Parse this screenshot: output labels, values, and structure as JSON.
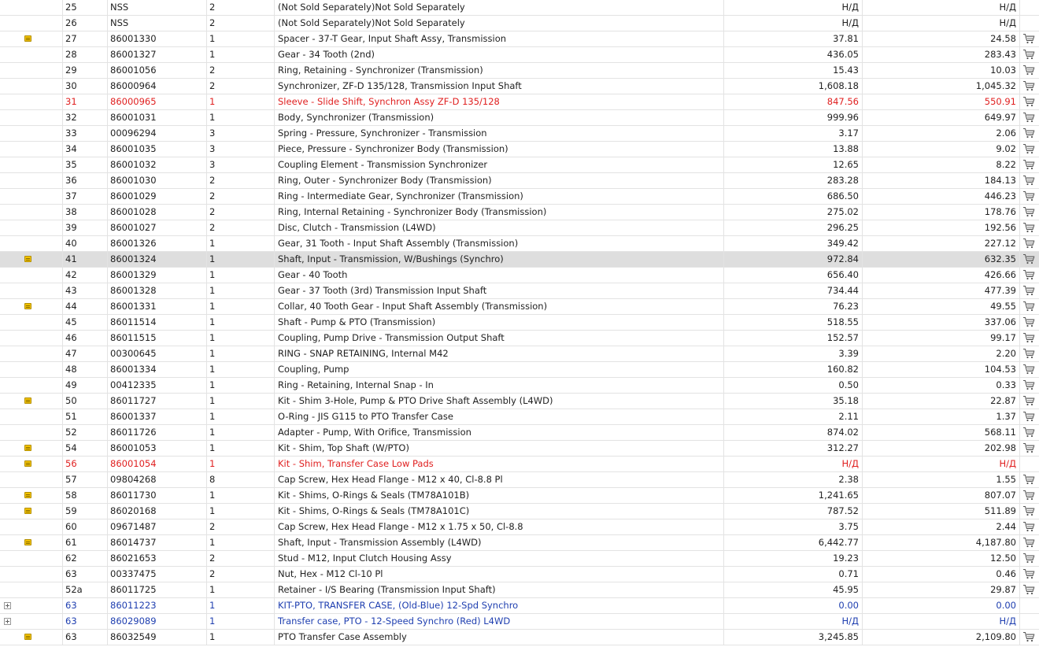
{
  "table": {
    "rows": [
      {
        "pos": "25",
        "part": "NSS",
        "qty": "2",
        "desc": "(Not Sold Separately)Not Sold Separately",
        "price": "Н/Д",
        "net": "Н/Д",
        "icon": "",
        "cart": false,
        "style": ""
      },
      {
        "pos": "26",
        "part": "NSS",
        "qty": "2",
        "desc": "(Not Sold Separately)Not Sold Separately",
        "price": "Н/Д",
        "net": "Н/Д",
        "icon": "",
        "cart": false,
        "style": ""
      },
      {
        "pos": "27",
        "part": "86001330",
        "qty": "1",
        "desc": "Spacer - 37-T Gear, Input Shaft Assy, Transmission",
        "price": "37.81",
        "net": "24.58",
        "icon": "note",
        "cart": true,
        "style": ""
      },
      {
        "pos": "28",
        "part": "86001327",
        "qty": "1",
        "desc": "Gear - 34 Tooth (2nd)",
        "price": "436.05",
        "net": "283.43",
        "icon": "",
        "cart": true,
        "style": ""
      },
      {
        "pos": "29",
        "part": "86001056",
        "qty": "2",
        "desc": "Ring, Retaining - Synchronizer (Transmission)",
        "price": "15.43",
        "net": "10.03",
        "icon": "",
        "cart": true,
        "style": ""
      },
      {
        "pos": "30",
        "part": "86000964",
        "qty": "2",
        "desc": "Synchronizer, ZF-D 135/128, Transmission Input Shaft",
        "price": "1,608.18",
        "net": "1,045.32",
        "icon": "",
        "cart": true,
        "style": ""
      },
      {
        "pos": "31",
        "part": "86000965",
        "qty": "1",
        "desc": "Sleeve - Slide Shift, Synchron Assy ZF-D 135/128",
        "price": "847.56",
        "net": "550.91",
        "icon": "",
        "cart": true,
        "style": "red"
      },
      {
        "pos": "32",
        "part": "86001031",
        "qty": "1",
        "desc": "Body, Synchronizer (Transmission)",
        "price": "999.96",
        "net": "649.97",
        "icon": "",
        "cart": true,
        "style": ""
      },
      {
        "pos": "33",
        "part": "00096294",
        "qty": "3",
        "desc": "Spring - Pressure, Synchronizer - Transmission",
        "price": "3.17",
        "net": "2.06",
        "icon": "",
        "cart": true,
        "style": ""
      },
      {
        "pos": "34",
        "part": "86001035",
        "qty": "3",
        "desc": "Piece, Pressure - Synchronizer Body (Transmission)",
        "price": "13.88",
        "net": "9.02",
        "icon": "",
        "cart": true,
        "style": ""
      },
      {
        "pos": "35",
        "part": "86001032",
        "qty": "3",
        "desc": "Coupling Element - Transmission Synchronizer",
        "price": "12.65",
        "net": "8.22",
        "icon": "",
        "cart": true,
        "style": ""
      },
      {
        "pos": "36",
        "part": "86001030",
        "qty": "2",
        "desc": "Ring, Outer - Synchronizer Body (Transmission)",
        "price": "283.28",
        "net": "184.13",
        "icon": "",
        "cart": true,
        "style": ""
      },
      {
        "pos": "37",
        "part": "86001029",
        "qty": "2",
        "desc": "Ring - Intermediate Gear, Synchronizer (Transmission)",
        "price": "686.50",
        "net": "446.23",
        "icon": "",
        "cart": true,
        "style": ""
      },
      {
        "pos": "38",
        "part": "86001028",
        "qty": "2",
        "desc": "Ring, Internal Retaining - Synchronizer Body (Transmission)",
        "price": "275.02",
        "net": "178.76",
        "icon": "",
        "cart": true,
        "style": ""
      },
      {
        "pos": "39",
        "part": "86001027",
        "qty": "2",
        "desc": "Disc, Clutch - Transmission (L4WD)",
        "price": "296.25",
        "net": "192.56",
        "icon": "",
        "cart": true,
        "style": ""
      },
      {
        "pos": "40",
        "part": "86001326",
        "qty": "1",
        "desc": "Gear, 31 Tooth - Input Shaft Assembly (Transmission)",
        "price": "349.42",
        "net": "227.12",
        "icon": "",
        "cart": true,
        "style": ""
      },
      {
        "pos": "41",
        "part": "86001324",
        "qty": "1",
        "desc": "Shaft, Input - Transmission, W/Bushings (Synchro)",
        "price": "972.84",
        "net": "632.35",
        "icon": "note",
        "cart": true,
        "style": "selected"
      },
      {
        "pos": "42",
        "part": "86001329",
        "qty": "1",
        "desc": "Gear - 40 Tooth",
        "price": "656.40",
        "net": "426.66",
        "icon": "",
        "cart": true,
        "style": ""
      },
      {
        "pos": "43",
        "part": "86001328",
        "qty": "1",
        "desc": "Gear - 37 Tooth (3rd) Transmission Input Shaft",
        "price": "734.44",
        "net": "477.39",
        "icon": "",
        "cart": true,
        "style": ""
      },
      {
        "pos": "44",
        "part": "86001331",
        "qty": "1",
        "desc": "Collar, 40 Tooth Gear - Input Shaft Assembly (Transmission)",
        "price": "76.23",
        "net": "49.55",
        "icon": "note",
        "cart": true,
        "style": ""
      },
      {
        "pos": "45",
        "part": "86011514",
        "qty": "1",
        "desc": "Shaft - Pump & PTO (Transmission)",
        "price": "518.55",
        "net": "337.06",
        "icon": "",
        "cart": true,
        "style": ""
      },
      {
        "pos": "46",
        "part": "86011515",
        "qty": "1",
        "desc": "Coupling, Pump Drive - Transmission Output Shaft",
        "price": "152.57",
        "net": "99.17",
        "icon": "",
        "cart": true,
        "style": ""
      },
      {
        "pos": "47",
        "part": "00300645",
        "qty": "1",
        "desc": "RING - SNAP RETAINING, Internal M42",
        "price": "3.39",
        "net": "2.20",
        "icon": "",
        "cart": true,
        "style": ""
      },
      {
        "pos": "48",
        "part": "86001334",
        "qty": "1",
        "desc": "Coupling, Pump",
        "price": "160.82",
        "net": "104.53",
        "icon": "",
        "cart": true,
        "style": ""
      },
      {
        "pos": "49",
        "part": "00412335",
        "qty": "1",
        "desc": "Ring - Retaining, Internal Snap - In",
        "price": "0.50",
        "net": "0.33",
        "icon": "",
        "cart": true,
        "style": ""
      },
      {
        "pos": "50",
        "part": "86011727",
        "qty": "1",
        "desc": "Kit - Shim 3-Hole, Pump & PTO Drive Shaft Assembly (L4WD)",
        "price": "35.18",
        "net": "22.87",
        "icon": "note",
        "cart": true,
        "style": ""
      },
      {
        "pos": "51",
        "part": "86001337",
        "qty": "1",
        "desc": "O-Ring - JIS G115 to PTO Transfer Case",
        "price": "2.11",
        "net": "1.37",
        "icon": "",
        "cart": true,
        "style": ""
      },
      {
        "pos": "52",
        "part": "86011726",
        "qty": "1",
        "desc": "Adapter - Pump, With Orifice, Transmission",
        "price": "874.02",
        "net": "568.11",
        "icon": "",
        "cart": true,
        "style": ""
      },
      {
        "pos": "54",
        "part": "86001053",
        "qty": "1",
        "desc": "Kit - Shim, Top Shaft (W/PTO)",
        "price": "312.27",
        "net": "202.98",
        "icon": "note",
        "cart": true,
        "style": ""
      },
      {
        "pos": "56",
        "part": "86001054",
        "qty": "1",
        "desc": "Kit - Shim, Transfer Case Low Pads",
        "price": "Н/Д",
        "net": "Н/Д",
        "icon": "note",
        "cart": false,
        "style": "red"
      },
      {
        "pos": "57",
        "part": "09804268",
        "qty": "8",
        "desc": "Cap Screw, Hex Head Flange - M12 x 40, Cl-8.8 Pl",
        "price": "2.38",
        "net": "1.55",
        "icon": "",
        "cart": true,
        "style": ""
      },
      {
        "pos": "58",
        "part": "86011730",
        "qty": "1",
        "desc": "Kit - Shims, O-Rings & Seals (TM78A101B)",
        "price": "1,241.65",
        "net": "807.07",
        "icon": "note",
        "cart": true,
        "style": ""
      },
      {
        "pos": "59",
        "part": "86020168",
        "qty": "1",
        "desc": "Kit - Shims, O-Rings & Seals (TM78A101C)",
        "price": "787.52",
        "net": "511.89",
        "icon": "note",
        "cart": true,
        "style": ""
      },
      {
        "pos": "60",
        "part": "09671487",
        "qty": "2",
        "desc": "Cap Screw, Hex Head Flange - M12 x 1.75 x 50, Cl-8.8",
        "price": "3.75",
        "net": "2.44",
        "icon": "",
        "cart": true,
        "style": ""
      },
      {
        "pos": "61",
        "part": "86014737",
        "qty": "1",
        "desc": "Shaft, Input - Transmission Assembly (L4WD)",
        "price": "6,442.77",
        "net": "4,187.80",
        "icon": "note",
        "cart": true,
        "style": ""
      },
      {
        "pos": "62",
        "part": "86021653",
        "qty": "2",
        "desc": "Stud - M12, Input Clutch Housing Assy",
        "price": "19.23",
        "net": "12.50",
        "icon": "",
        "cart": true,
        "style": ""
      },
      {
        "pos": "63",
        "part": "00337475",
        "qty": "2",
        "desc": "Nut, Hex - M12 Cl-10 Pl",
        "price": "0.71",
        "net": "0.46",
        "icon": "",
        "cart": true,
        "style": ""
      },
      {
        "pos": "52a",
        "part": "86011725",
        "qty": "1",
        "desc": "Retainer - I/S Bearing (Transmission Input Shaft)",
        "price": "45.95",
        "net": "29.87",
        "icon": "",
        "cart": true,
        "style": ""
      },
      {
        "pos": "63",
        "part": "86011223",
        "qty": "1",
        "desc": "KIT-PTO, TRANSFER CASE, (Old-Blue) 12-Spd Synchro",
        "price": "0.00",
        "net": "0.00",
        "icon": "expand",
        "cart": false,
        "style": "blue"
      },
      {
        "pos": "63",
        "part": "86029089",
        "qty": "1",
        "desc": "Transfer case, PTO - 12-Speed Synchro (Red) L4WD",
        "price": "Н/Д",
        "net": "Н/Д",
        "icon": "expand",
        "cart": false,
        "style": "blue"
      },
      {
        "pos": "63",
        "part": "86032549",
        "qty": "1",
        "desc": "PTO Transfer Case Assembly",
        "price": "3,245.85",
        "net": "2,109.80",
        "icon": "note",
        "cart": true,
        "style": ""
      }
    ]
  }
}
